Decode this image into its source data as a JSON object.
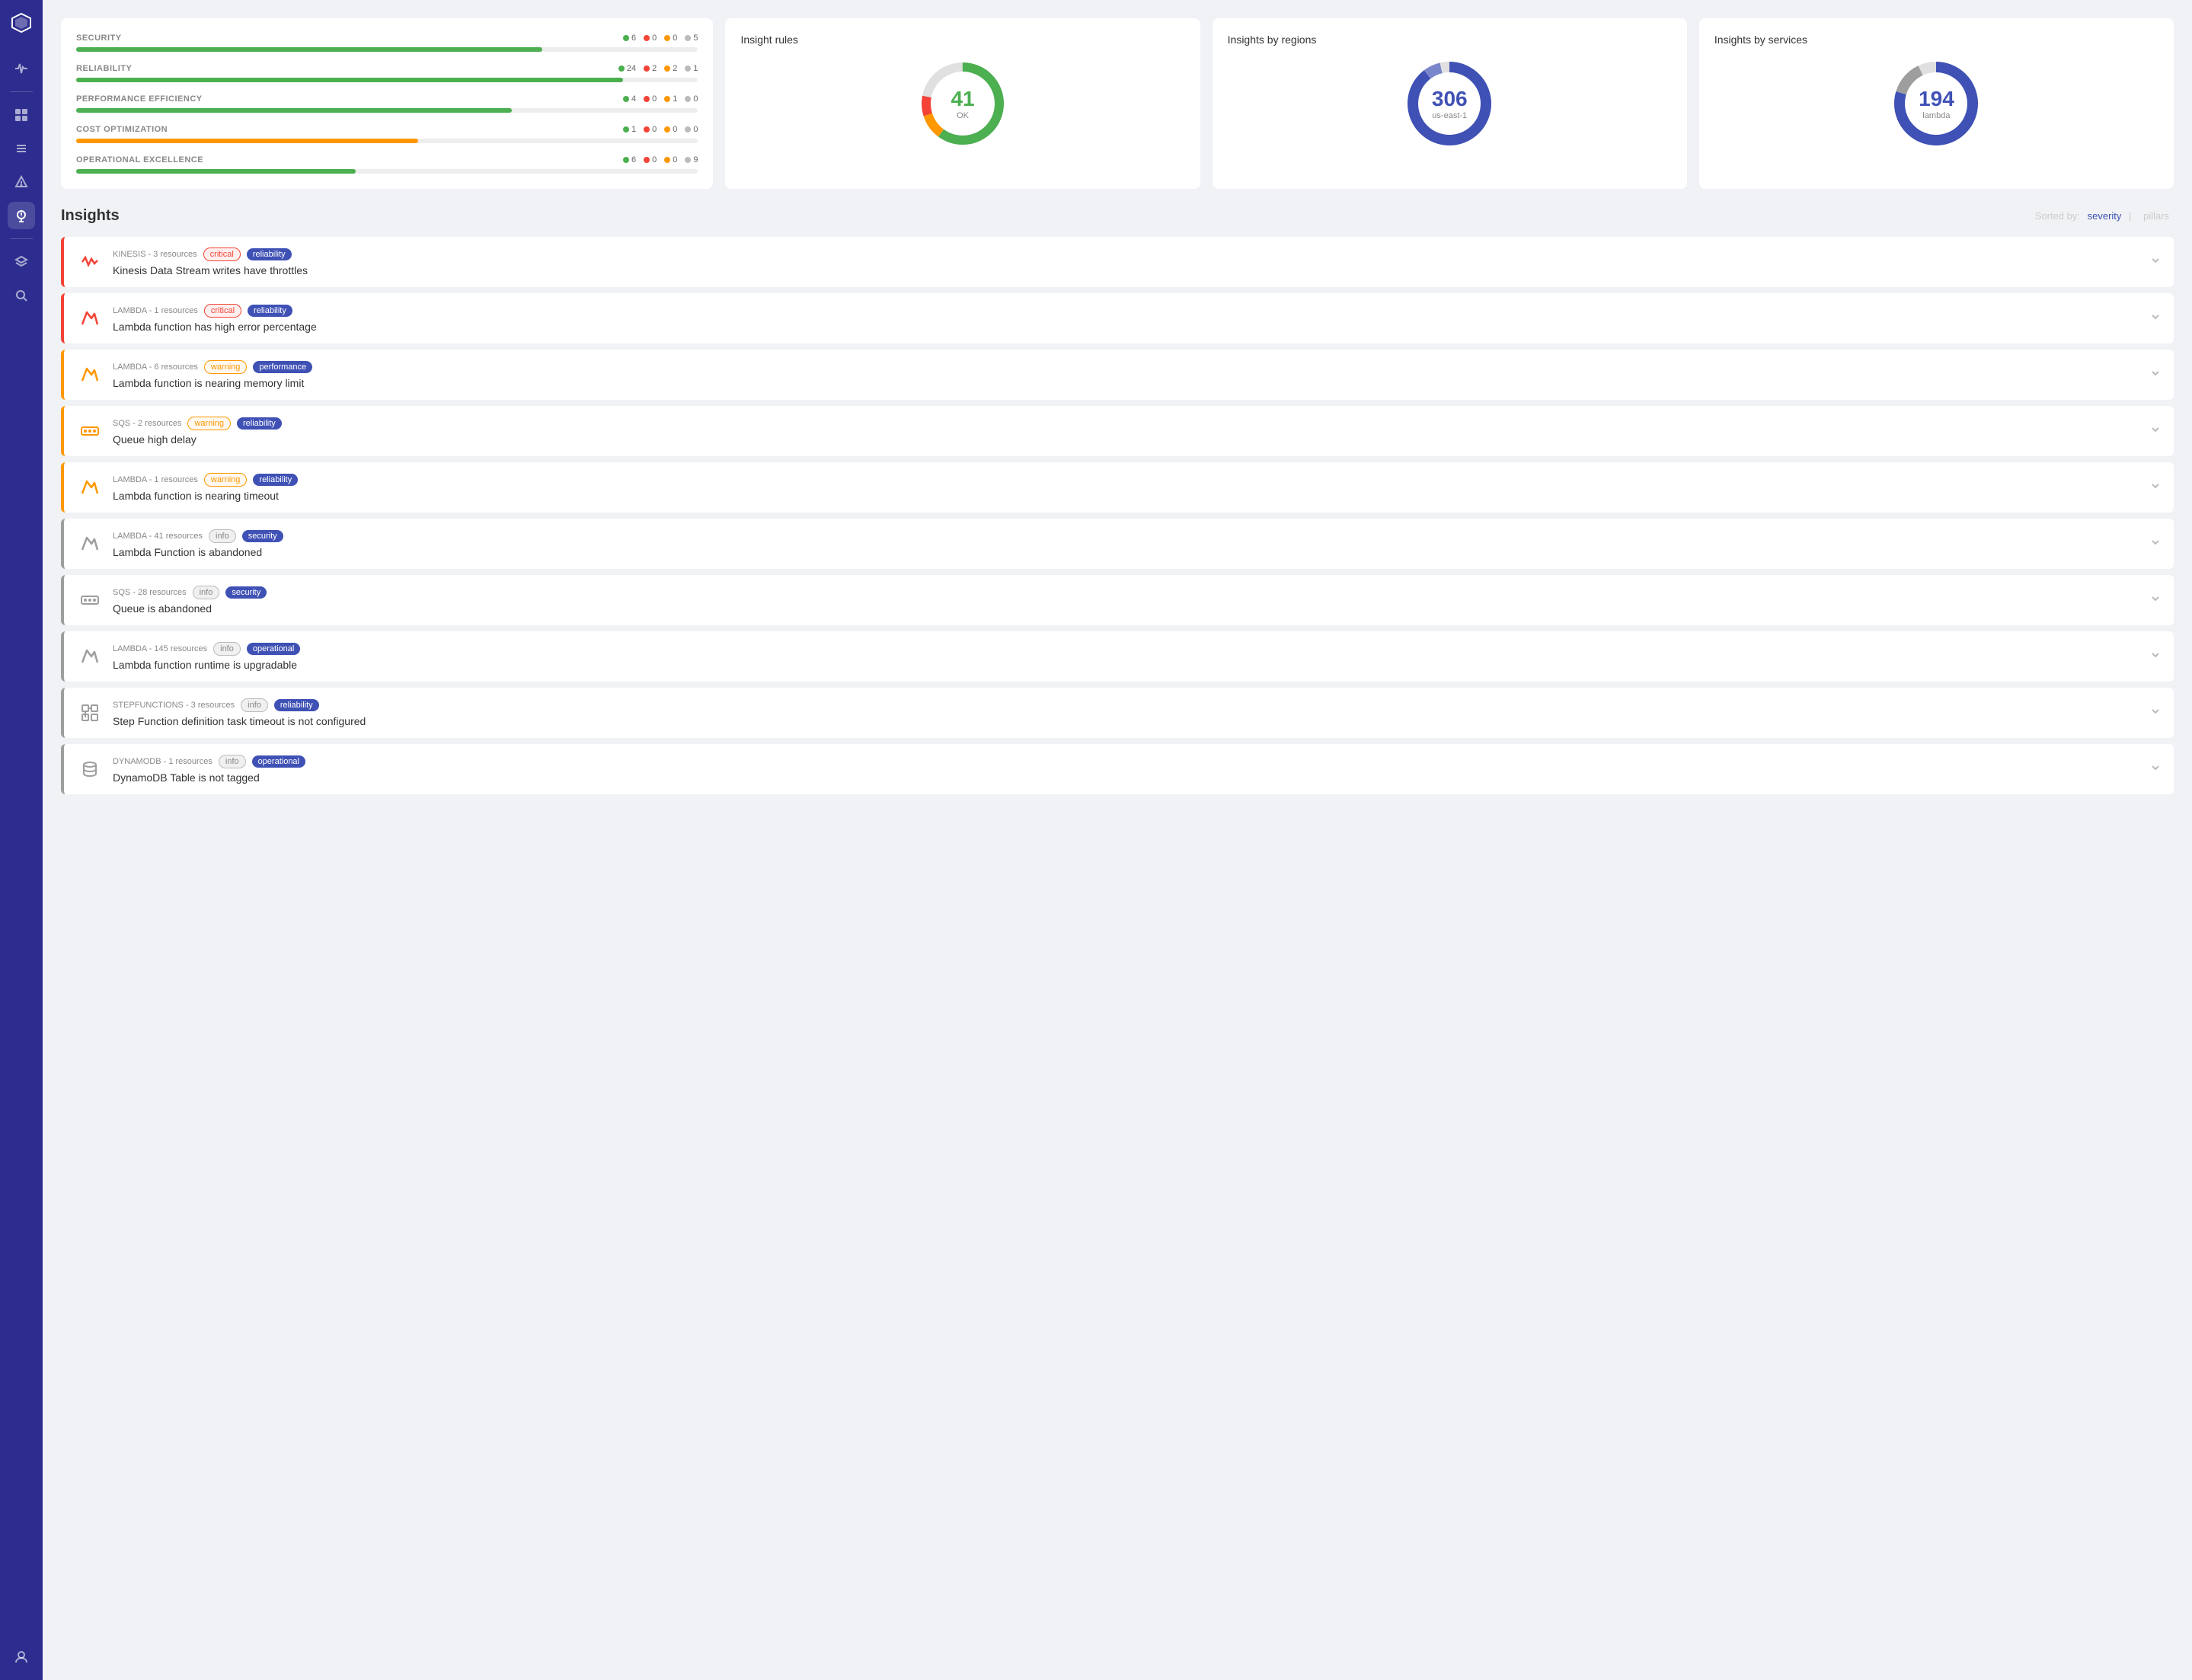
{
  "sidebar": {
    "logo": "✦",
    "items": [
      {
        "name": "pulse-icon",
        "icon": "〜",
        "active": false
      },
      {
        "name": "dashboard-icon",
        "icon": "▦",
        "active": false
      },
      {
        "name": "list-icon",
        "icon": "≡",
        "active": false
      },
      {
        "name": "alert-icon",
        "icon": "△",
        "active": false
      },
      {
        "name": "insights-icon",
        "icon": "💡",
        "active": true
      },
      {
        "name": "layers-icon",
        "icon": "◫",
        "active": false
      },
      {
        "name": "search-icon",
        "icon": "⌕",
        "active": false
      },
      {
        "name": "user-icon",
        "icon": "⚬",
        "active": false
      }
    ]
  },
  "pillars": [
    {
      "name": "SECURITY",
      "green": 6,
      "red": 0,
      "orange": 0,
      "gray": 5,
      "width": 75,
      "color": "green"
    },
    {
      "name": "RELIABILITY",
      "green": 24,
      "red": 2,
      "orange": 2,
      "gray": 1,
      "width": 88,
      "color": "green"
    },
    {
      "name": "PERFORMANCE EFFICIENCY",
      "green": 4,
      "red": 0,
      "orange": 1,
      "gray": 0,
      "width": 70,
      "color": "green"
    },
    {
      "name": "COST OPTIMIZATION",
      "green": 1,
      "red": 0,
      "orange": 0,
      "gray": 0,
      "width": 55,
      "color": "orange"
    },
    {
      "name": "OPERATIONAL EXCELLENCE",
      "green": 6,
      "red": 0,
      "orange": 0,
      "gray": 9,
      "width": 45,
      "color": "green"
    }
  ],
  "insight_rules": {
    "title": "Insight rules",
    "number": "41",
    "label": "OK",
    "color": "#4caf50",
    "segments": [
      {
        "value": 60,
        "color": "#4caf50"
      },
      {
        "value": 15,
        "color": "#f44336"
      },
      {
        "value": 15,
        "color": "#ff9800"
      },
      {
        "value": 10,
        "color": "#e0e0e0"
      }
    ]
  },
  "insights_by_regions": {
    "title": "Insights by regions",
    "number": "306",
    "label": "us-east-1",
    "color": "#3f51b5"
  },
  "insights_by_services": {
    "title": "Insights by services",
    "number": "194",
    "label": "lambda",
    "color": "#3f51b5"
  },
  "insights_section": {
    "title": "Insights",
    "sort_label": "Sorted by:",
    "sort_severity": "severity",
    "sort_pillars": "pillars"
  },
  "insights": [
    {
      "service": "KINESIS",
      "resources": "3 resources",
      "severity": "critical",
      "pillar": "reliability",
      "description": "Kinesis Data Stream writes have throttles",
      "icon_type": "kinesis"
    },
    {
      "service": "LAMBDA",
      "resources": "1 resources",
      "severity": "critical",
      "pillar": "reliability",
      "description": "Lambda function has high error percentage",
      "icon_type": "lambda"
    },
    {
      "service": "LAMBDA",
      "resources": "6 resources",
      "severity": "warning",
      "pillar": "performance",
      "description": "Lambda function is nearing memory limit",
      "icon_type": "lambda"
    },
    {
      "service": "SQS",
      "resources": "2 resources",
      "severity": "warning",
      "pillar": "reliability",
      "description": "Queue high delay",
      "icon_type": "sqs"
    },
    {
      "service": "LAMBDA",
      "resources": "1 resources",
      "severity": "warning",
      "pillar": "reliability",
      "description": "Lambda function is nearing timeout",
      "icon_type": "lambda"
    },
    {
      "service": "LAMBDA",
      "resources": "41 resources",
      "severity": "info",
      "pillar": "security",
      "description": "Lambda Function is abandoned",
      "icon_type": "lambda"
    },
    {
      "service": "SQS",
      "resources": "28 resources",
      "severity": "info",
      "pillar": "security",
      "description": "Queue is abandoned",
      "icon_type": "sqs"
    },
    {
      "service": "LAMBDA",
      "resources": "145 resources",
      "severity": "info",
      "pillar": "operational",
      "description": "Lambda function runtime is upgradable",
      "icon_type": "lambda"
    },
    {
      "service": "STEPFUNCTIONS",
      "resources": "3 resources",
      "severity": "info",
      "pillar": "reliability",
      "description": "Step Function definition task timeout is not configured",
      "icon_type": "stepfunctions"
    },
    {
      "service": "DYNAMODB",
      "resources": "1 resources",
      "severity": "info",
      "pillar": "operational",
      "description": "DynamoDB Table is not tagged",
      "icon_type": "dynamodb"
    }
  ]
}
